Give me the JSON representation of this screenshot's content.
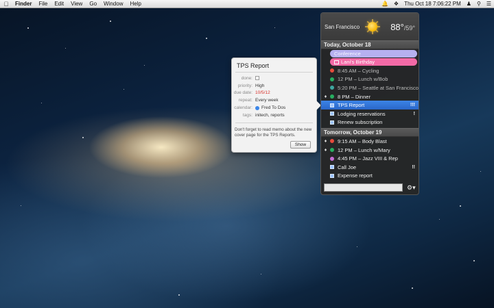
{
  "menubar": {
    "app_name": "Finder",
    "menus": [
      "File",
      "Edit",
      "View",
      "Go",
      "Window",
      "Help"
    ],
    "clock": "Thu Oct 18  7:06:22 PM"
  },
  "weather": {
    "city": "San Francisco",
    "high": "88°",
    "low": "/59°"
  },
  "today": {
    "header": "Today, October 18",
    "allday": [
      {
        "label": "Conference"
      },
      {
        "label": "Lani's Birthday"
      }
    ],
    "events": [
      {
        "text": "8:45 AM – Cycling",
        "color": "#e74c3c"
      },
      {
        "text": "12 PM – Lunch w/Bob",
        "color": "#27ae60"
      },
      {
        "text": "5:20 PM – Seattle at San Francisco",
        "color": "#3fa7a0"
      },
      {
        "text": "8 PM – Dinner",
        "color": "#27ae60"
      }
    ],
    "reminders": [
      {
        "text": "TPS Report",
        "flag": "!!!"
      },
      {
        "text": "Lodging reservations",
        "flag": "!"
      },
      {
        "text": "Renew subscription",
        "flag": ""
      }
    ]
  },
  "tomorrow": {
    "header": "Tomorrow, October 19",
    "events": [
      {
        "text": "9:15 AM – Body Blast",
        "color": "#e74c3c"
      },
      {
        "text": "12 PM – Lunch w/Mary",
        "color": "#27ae60"
      },
      {
        "text": "4:45 PM – Jazz VIII & Rep",
        "color": "#c46fd4"
      }
    ],
    "reminders": [
      {
        "text": "Call Joe",
        "flag": "!!"
      },
      {
        "text": "Expense report",
        "flag": ""
      }
    ]
  },
  "popover": {
    "title": "TPS Report",
    "fields": [
      {
        "label": "done:",
        "value": ""
      },
      {
        "label": "priority:",
        "value": "High"
      },
      {
        "label": "due date:",
        "value": "10/5/12"
      },
      {
        "label": "repeat:",
        "value": "Every week"
      },
      {
        "label": "calendar:",
        "value": "Fred To Dos"
      },
      {
        "label": "tags:",
        "value": "initech, reports"
      }
    ],
    "note": "Don't forget to read memo about the new cover page for the TPS Reports.",
    "show_label": "Show"
  },
  "colors": {
    "selection": "#2f73d8",
    "due_date": "#d8302a",
    "birthday": "#f36aa6",
    "conference": "#b6b0f0"
  }
}
